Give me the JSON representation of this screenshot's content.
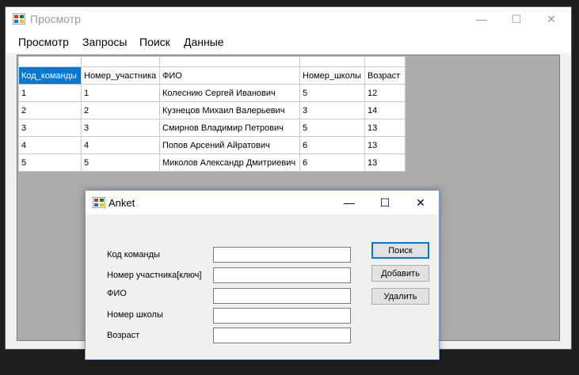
{
  "main_window": {
    "title": "Просмотр",
    "minimize": "—",
    "maximize": "☐",
    "close": "✕"
  },
  "menu": {
    "items": [
      "Просмотр",
      "Запросы",
      "Поиск",
      "Данные"
    ]
  },
  "grid": {
    "columns": [
      "Код_команды",
      "Номер_участника",
      "ФИО",
      "Номер_школы",
      "Возраст"
    ],
    "rows": [
      [
        "1",
        "1",
        "Колеснию Сергей Иванович",
        "5",
        "12"
      ],
      [
        "2",
        "2",
        "Кузнецов Михаил Валерьевич",
        "3",
        "14"
      ],
      [
        "3",
        "3",
        "Смирнов Владимир Петрович",
        "5",
        "13"
      ],
      [
        "4",
        "4",
        "Попов Арсений Айратович",
        "6",
        "13"
      ],
      [
        "5",
        "5",
        "Миколов Александр Дмитриевич",
        "6",
        "13"
      ]
    ]
  },
  "dialog": {
    "title": "Anket",
    "minimize": "—",
    "maximize": "☐",
    "close": "✕",
    "fields": [
      {
        "label": "Код команды",
        "value": ""
      },
      {
        "label": "Номер участника[ключ]",
        "value": ""
      },
      {
        "label": "ФИО",
        "value": ""
      },
      {
        "label": "Номер школы",
        "value": ""
      },
      {
        "label": "Возраст",
        "value": ""
      }
    ],
    "buttons": {
      "search": "Поиск",
      "add": "Добавить",
      "delete": "Удалить"
    }
  },
  "colors": {
    "selection": "#0078d7",
    "mdi_background": "#ababab"
  }
}
